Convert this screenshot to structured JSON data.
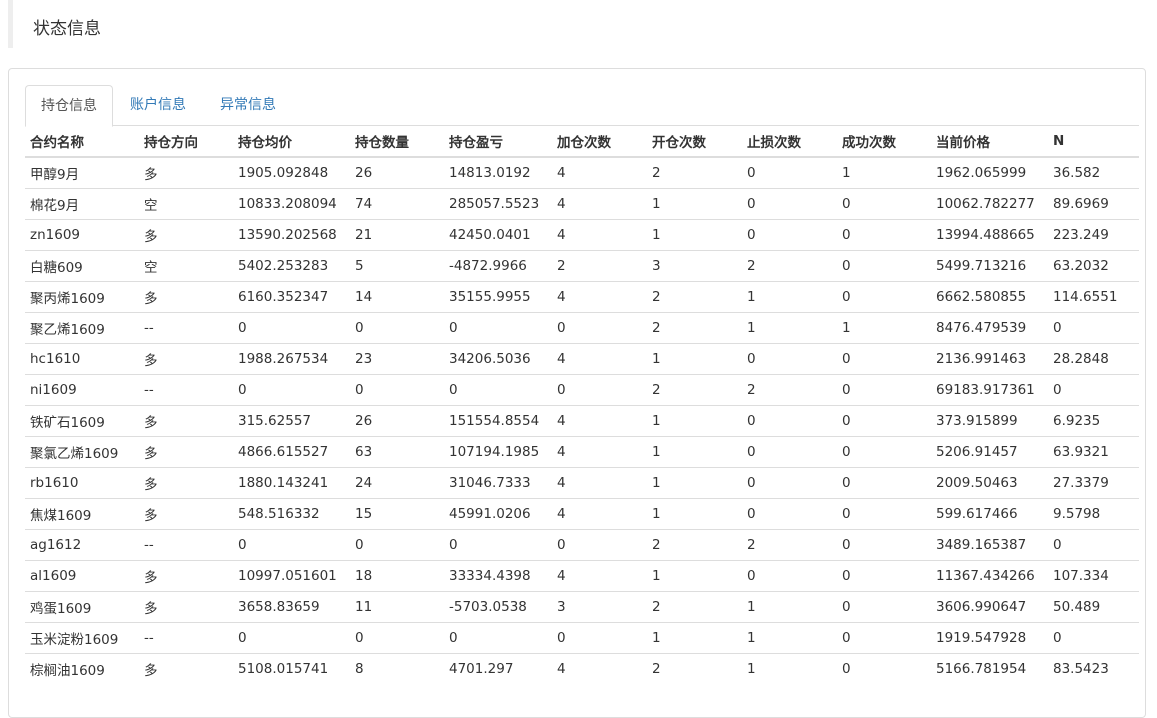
{
  "header": {
    "title": "状态信息"
  },
  "tabs": [
    {
      "label": "持仓信息",
      "active": true
    },
    {
      "label": "账户信息",
      "active": false
    },
    {
      "label": "异常信息",
      "active": false
    }
  ],
  "table": {
    "columns": [
      "合约名称",
      "持仓方向",
      "持仓均价",
      "持仓数量",
      "持仓盈亏",
      "加仓次数",
      "开仓次数",
      "止损次数",
      "成功次数",
      "当前价格",
      "N"
    ],
    "rows": [
      [
        "甲醇9月",
        "多",
        "1905.092848",
        "26",
        "14813.0192",
        "4",
        "2",
        "0",
        "1",
        "1962.065999",
        "36.582"
      ],
      [
        "棉花9月",
        "空",
        "10833.208094",
        "74",
        "285057.5523",
        "4",
        "1",
        "0",
        "0",
        "10062.782277",
        "89.6969"
      ],
      [
        "zn1609",
        "多",
        "13590.202568",
        "21",
        "42450.0401",
        "4",
        "1",
        "0",
        "0",
        "13994.488665",
        "223.249"
      ],
      [
        "白糖609",
        "空",
        "5402.253283",
        "5",
        "-4872.9966",
        "2",
        "3",
        "2",
        "0",
        "5499.713216",
        "63.2032"
      ],
      [
        "聚丙烯1609",
        "多",
        "6160.352347",
        "14",
        "35155.9955",
        "4",
        "2",
        "1",
        "0",
        "6662.580855",
        "114.6551"
      ],
      [
        "聚乙烯1609",
        "--",
        "0",
        "0",
        "0",
        "0",
        "2",
        "1",
        "1",
        "8476.479539",
        "0"
      ],
      [
        "hc1610",
        "多",
        "1988.267534",
        "23",
        "34206.5036",
        "4",
        "1",
        "0",
        "0",
        "2136.991463",
        "28.2848"
      ],
      [
        "ni1609",
        "--",
        "0",
        "0",
        "0",
        "0",
        "2",
        "2",
        "0",
        "69183.917361",
        "0"
      ],
      [
        "铁矿石1609",
        "多",
        "315.62557",
        "26",
        "151554.8554",
        "4",
        "1",
        "0",
        "0",
        "373.915899",
        "6.9235"
      ],
      [
        "聚氯乙烯1609",
        "多",
        "4866.615527",
        "63",
        "107194.1985",
        "4",
        "1",
        "0",
        "0",
        "5206.91457",
        "63.9321"
      ],
      [
        "rb1610",
        "多",
        "1880.143241",
        "24",
        "31046.7333",
        "4",
        "1",
        "0",
        "0",
        "2009.50463",
        "27.3379"
      ],
      [
        "焦煤1609",
        "多",
        "548.516332",
        "15",
        "45991.0206",
        "4",
        "1",
        "0",
        "0",
        "599.617466",
        "9.5798"
      ],
      [
        "ag1612",
        "--",
        "0",
        "0",
        "0",
        "0",
        "2",
        "2",
        "0",
        "3489.165387",
        "0"
      ],
      [
        "al1609",
        "多",
        "10997.051601",
        "18",
        "33334.4398",
        "4",
        "1",
        "0",
        "0",
        "11367.434266",
        "107.334"
      ],
      [
        "鸡蛋1609",
        "多",
        "3658.83659",
        "11",
        "-5703.0538",
        "3",
        "2",
        "1",
        "0",
        "3606.990647",
        "50.489"
      ],
      [
        "玉米淀粉1609",
        "--",
        "0",
        "0",
        "0",
        "0",
        "1",
        "1",
        "0",
        "1919.547928",
        "0"
      ],
      [
        "棕榈油1609",
        "多",
        "5108.015741",
        "8",
        "4701.297",
        "4",
        "2",
        "1",
        "0",
        "5166.781954",
        "83.5423"
      ]
    ]
  }
}
